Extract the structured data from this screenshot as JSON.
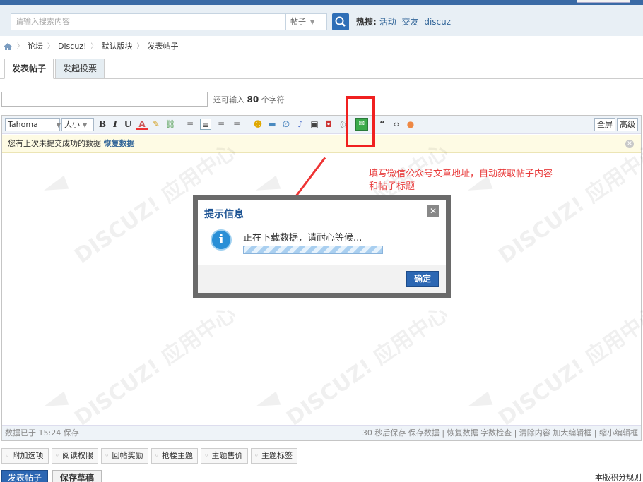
{
  "search": {
    "placeholder": "请输入搜索内容",
    "type_label": "帖子",
    "hot_label": "热搜:",
    "hot_tags": [
      "活动",
      "交友",
      "discuz"
    ]
  },
  "breadcrumb": [
    "论坛",
    "Discuz!",
    "默认版块",
    "发表帖子"
  ],
  "tabs": [
    {
      "label": "发表帖子",
      "active": true
    },
    {
      "label": "发起投票",
      "active": false
    }
  ],
  "subject": {
    "value": "",
    "remaining_prefix": "还可输入",
    "remaining_count": "80",
    "remaining_suffix": "个字符"
  },
  "toolbar": {
    "font": "Tahoma",
    "size": "大小",
    "fullscreen_label": "全屏",
    "advanced_label": "高级"
  },
  "notice": {
    "text": "您有上次未提交成功的数据",
    "link": "恢复数据"
  },
  "status": {
    "left": "数据已于 15:24 保存",
    "right": "30 秒后保存 保存数据 | 恢复数据   字数检查 | 清除内容   加大编辑框 | 缩小编辑框"
  },
  "annotation": {
    "line1": "填写微信公众号文章地址，自动获取帖子内容",
    "line2": "和帖子标题"
  },
  "dialog": {
    "title": "提示信息",
    "message": "正在下载数据，请耐心等候...",
    "ok_label": "确定"
  },
  "extras": [
    "附加选项",
    "阅读权限",
    "回帖奖励",
    "抢楼主题",
    "主题售价",
    "主题标签"
  ],
  "buttons": {
    "submit": "发表帖子",
    "draft": "保存草稿",
    "rules": "本版积分规则"
  },
  "colors": {
    "accent": "#2c67b3",
    "highlight": "#f02020",
    "annotation": "#e83c3c"
  }
}
